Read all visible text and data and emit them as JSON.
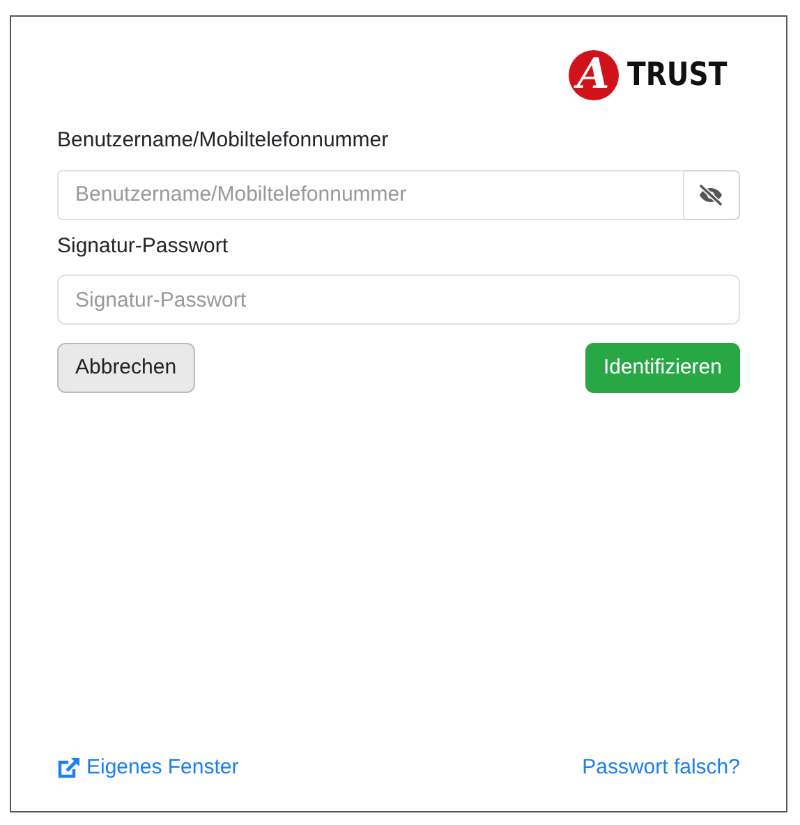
{
  "logo": {
    "mark": "A",
    "text": "TRUST"
  },
  "fields": [
    {
      "label": "Benutzername/Mobiltelefonnummer",
      "placeholder": "Benutzername/Mobiltelefonnummer",
      "kind": "toggle"
    },
    {
      "label": "Signatur-Passwort",
      "placeholder": "Signatur-Passwort",
      "kind": "plain"
    }
  ],
  "buttons": [
    {
      "label": "Abbrechen",
      "kind": "secondary"
    },
    {
      "label": "Identifizieren",
      "kind": "primary"
    }
  ],
  "footer_links": [
    {
      "label": "Eigenes Fenster",
      "kind": "external"
    },
    {
      "label": "Passwort falsch?",
      "kind": "plain"
    }
  ]
}
